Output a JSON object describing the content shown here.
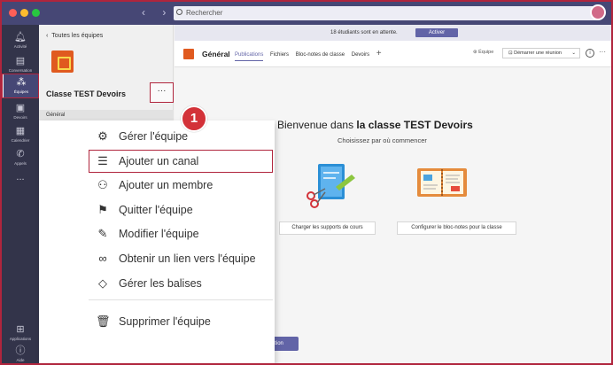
{
  "search": {
    "placeholder": "Rechercher"
  },
  "rail": {
    "items": [
      {
        "label": "Activité",
        "icon": "bell-icon"
      },
      {
        "label": "Conversation",
        "icon": "chat-icon"
      },
      {
        "label": "Équipes",
        "icon": "teams-icon"
      },
      {
        "label": "Devoirs",
        "icon": "assignments-icon"
      },
      {
        "label": "Calendrier",
        "icon": "calendar-icon"
      },
      {
        "label": "Appels",
        "icon": "phone-icon"
      },
      {
        "label": "...",
        "icon": "more-icon"
      },
      {
        "label": "Applications",
        "icon": "apps-icon"
      },
      {
        "label": "Aide",
        "icon": "help-icon"
      }
    ]
  },
  "team_panel": {
    "back_label": "Toutes les équipes",
    "team_name": "Classe TEST Devoirs",
    "more_label": "···",
    "channel": "Général"
  },
  "banner": {
    "text": "18 étudiants sont en attente.",
    "button": "Activer"
  },
  "channel_bar": {
    "title": "Général",
    "tabs": [
      "Publications",
      "Fichiers",
      "Bloc-notes de classe",
      "Devoirs"
    ],
    "plus": "+",
    "team_button": "Équipe",
    "meet_button": "Démarrer une réunion",
    "info": "i",
    "dots": "···"
  },
  "welcome": {
    "prefix": "Bienvenue dans ",
    "team": "la classe TEST Devoirs",
    "subtitle": "Choisissez par où commencer"
  },
  "cards": {
    "upload": "Charger les supports de cours",
    "notebook": "Configurer le bloc-notes pour la classe"
  },
  "new_conversation": "Nouvelle conversation",
  "menu": {
    "items": [
      {
        "label": "Gérer l'équipe",
        "icon": "gear-icon"
      },
      {
        "label": "Ajouter un canal",
        "icon": "channel-icon"
      },
      {
        "label": "Ajouter un membre",
        "icon": "add-person-icon"
      },
      {
        "label": "Quitter l'équipe",
        "icon": "leave-icon"
      },
      {
        "label": "Modifier l'équipe",
        "icon": "pencil-icon"
      },
      {
        "label": "Obtenir un lien vers l'équipe",
        "icon": "link-icon"
      },
      {
        "label": "Gérer les balises",
        "icon": "tag-icon"
      },
      {
        "label": "Supprimer l'équipe",
        "icon": "trash-icon"
      }
    ]
  },
  "step_badge": "1",
  "colors": {
    "accent": "#6264a7",
    "rail": "#33344a",
    "titlebar": "#464775",
    "highlight": "#b0253d",
    "badge": "#d33239"
  }
}
